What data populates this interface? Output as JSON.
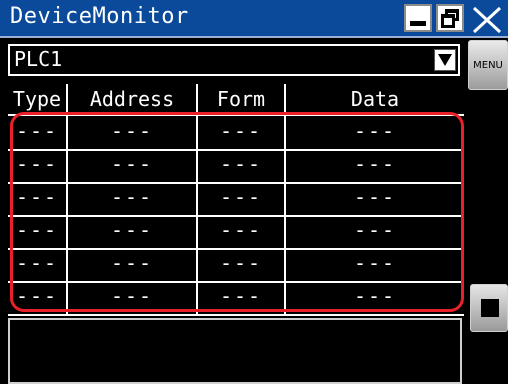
{
  "window": {
    "title": "DeviceMonitor",
    "colors": {
      "titlebar": "#0b4a9a",
      "highlight": "#e8202a",
      "background": "#000000"
    }
  },
  "selector": {
    "value": "PLC1"
  },
  "side_buttons": {
    "menu_label": "MENU"
  },
  "table": {
    "headers": [
      "Type",
      "Address",
      "Form",
      "Data"
    ],
    "rows": [
      [
        "---",
        "---",
        "---",
        "---"
      ],
      [
        "---",
        "---",
        "---",
        "---"
      ],
      [
        "---",
        "---",
        "---",
        "---"
      ],
      [
        "---",
        "---",
        "---",
        "---"
      ],
      [
        "---",
        "---",
        "---",
        "---"
      ],
      [
        "---",
        "---",
        "---",
        "---"
      ]
    ]
  },
  "message": ""
}
